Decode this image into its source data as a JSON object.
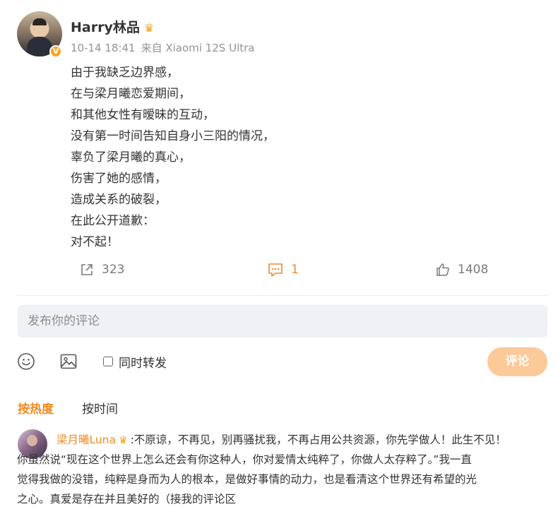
{
  "post": {
    "author": "Harry林品",
    "author_badge_icon": "crown-icon",
    "verified_icon": "verified-v-icon",
    "timestamp": "10-14 18:41",
    "source": "来自 Xiaomi 12S Ultra",
    "lines": [
      "由于我缺乏边界感，",
      "在与梁月曦恋爱期间，",
      "和其他女性有暧昧的互动，",
      "没有第一时间告知自身小三阳的情况，",
      "辜负了梁月曦的真心，",
      "伤害了她的感情，",
      "造成关系的破裂，",
      "在此公开道歉：",
      "对不起！"
    ],
    "actions": {
      "repost_count": "323",
      "comment_count": "1",
      "like_count": "1408"
    }
  },
  "composer": {
    "placeholder": "发布你的评论",
    "forward_label": "同时转发",
    "submit_label": "评论"
  },
  "sort": {
    "hot": "按热度",
    "time": "按时间"
  },
  "comment": {
    "author": "梁月曦Luna",
    "line1": ":不原谅，不再见，别再骚扰我，不再占用公共资源，你先学做人！此生不见！",
    "line2": "你虽然说“现在这个世界上怎么还会有你这种人，你对爱情太纯粹了，你做人太存粹了。”我一直",
    "line3": "觉得我做的没错，纯粹是身而为人的根本，是做好事情的动力，也是看清这个世界还有希望的光",
    "line4": "之心。真爱是存在并且美好的（接我的评论区"
  },
  "colors": {
    "accent": "#f08a24",
    "submit_disabled": "#fcc998",
    "input_bg": "#eff1f5",
    "meta_text": "#939393"
  }
}
